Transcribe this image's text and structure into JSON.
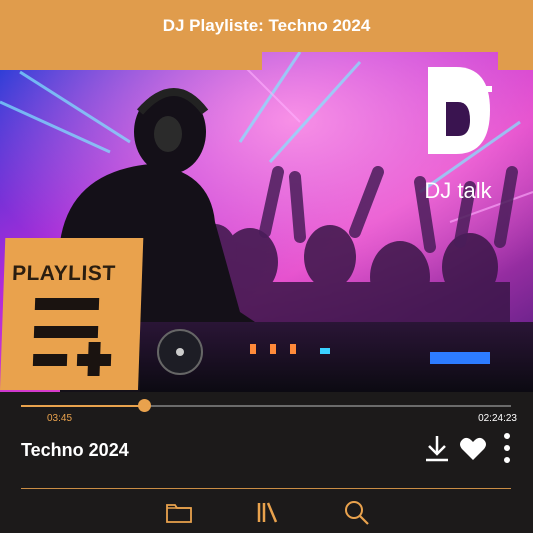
{
  "header": {
    "title": "DJ Playliste: Techno 2024"
  },
  "hero": {
    "logo_text": "DJ talk",
    "badge_label": "PLAYLIST"
  },
  "player": {
    "current_time": "03:45",
    "total_time": "02:24:23",
    "progress": 0.25,
    "track_title": "Techno 2024",
    "accent_color": "#e9a24d"
  },
  "actions": [
    "download-icon",
    "heart-icon",
    "more-vertical-icon"
  ],
  "bottom_nav": [
    "folder-icon",
    "library-icon",
    "search-icon"
  ]
}
